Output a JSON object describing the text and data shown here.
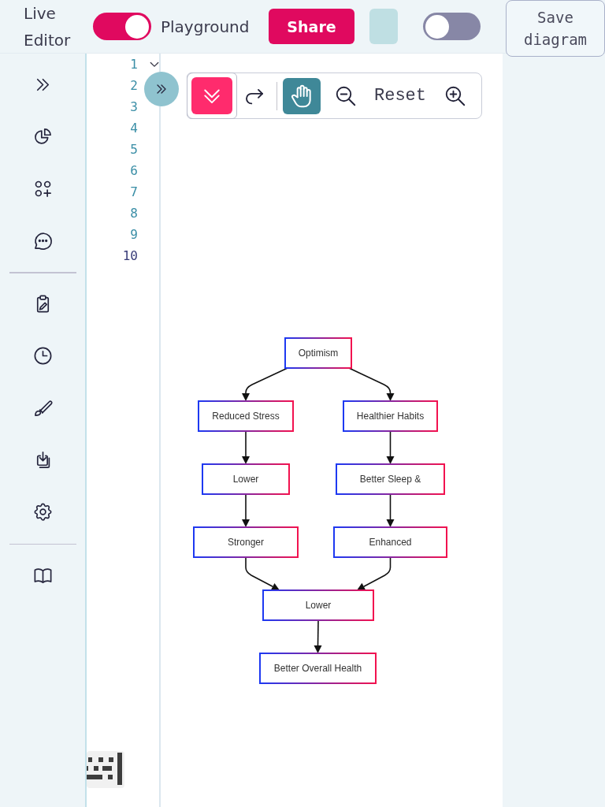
{
  "header": {
    "title": "Live Editor",
    "mode_toggle": {
      "on": true
    },
    "mode_label": "Playground",
    "share_button": "Share",
    "theme_toggle": {
      "on": false
    },
    "save_button": "Save diagram"
  },
  "editor": {
    "lines": [
      {
        "number": "1",
        "fold_marker": true,
        "active": false
      },
      {
        "number": "2",
        "fold_marker": false,
        "active": false
      },
      {
        "number": "3",
        "fold_marker": false,
        "active": false
      },
      {
        "number": "4",
        "fold_marker": false,
        "active": false
      },
      {
        "number": "5",
        "fold_marker": false,
        "active": false
      },
      {
        "number": "6",
        "fold_marker": false,
        "active": false
      },
      {
        "number": "7",
        "fold_marker": false,
        "active": false
      },
      {
        "number": "8",
        "fold_marker": false,
        "active": false
      },
      {
        "number": "9",
        "fold_marker": false,
        "active": false
      },
      {
        "number": "10",
        "fold_marker": false,
        "active": true
      }
    ]
  },
  "toolbar": {
    "groups": [
      [
        {
          "kind": "collapse",
          "active": true
        },
        {
          "kind": "redo",
          "active": false
        }
      ],
      [
        {
          "kind": "pan",
          "active": true
        },
        {
          "kind": "zoom_out",
          "active": false
        },
        {
          "kind": "reset",
          "label": "Reset",
          "active": false
        },
        {
          "kind": "zoom_in",
          "active": false
        }
      ]
    ]
  },
  "diagram": {
    "nodes": [
      {
        "label": "Optimism"
      },
      {
        "label": "Reduced Stress"
      },
      {
        "label": "Healthier Habits"
      },
      {
        "label": "Lower"
      },
      {
        "label": "Better Sleep &"
      },
      {
        "label": "Stronger"
      },
      {
        "label": "Enhanced"
      },
      {
        "label": "Lower"
      },
      {
        "label": "Better Overall Health"
      }
    ]
  }
}
